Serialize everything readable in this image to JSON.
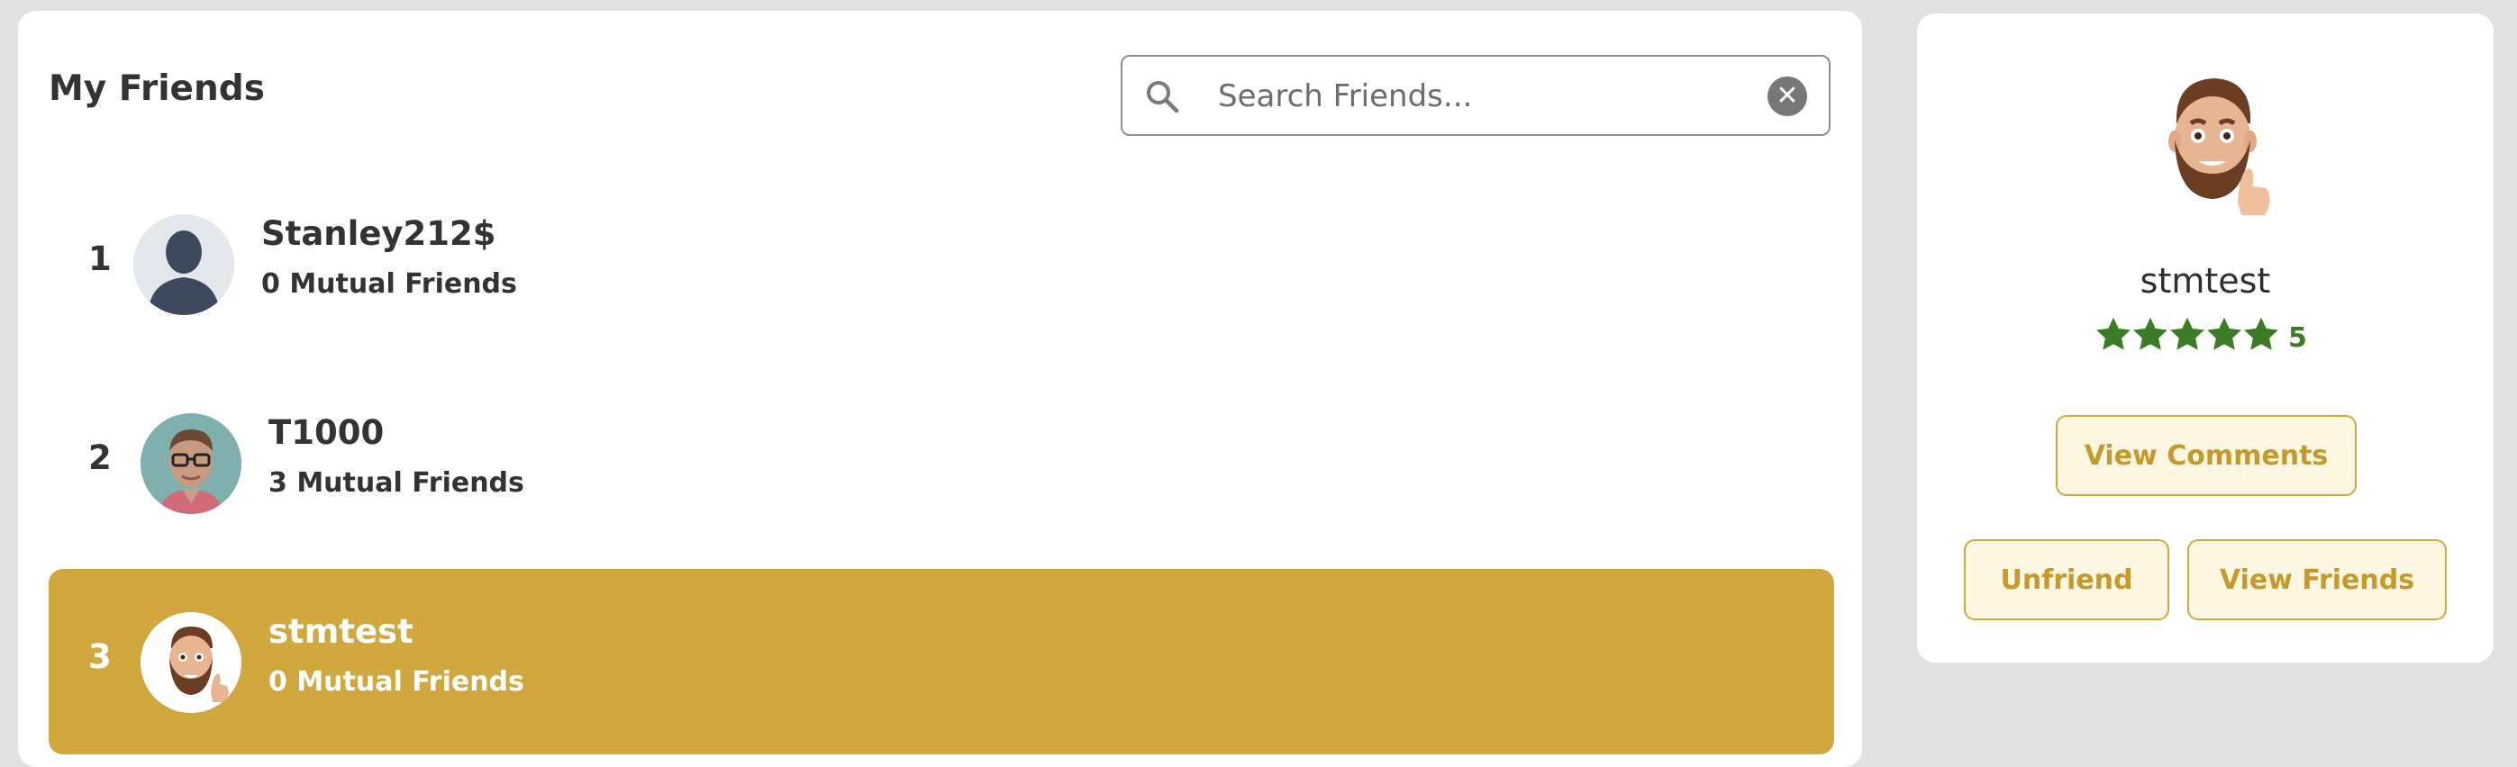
{
  "friends_panel": {
    "title": "My Friends",
    "search": {
      "placeholder": "Search Friends...",
      "value": ""
    },
    "friends": [
      {
        "rank": "1",
        "name": "Stanley212$",
        "mutual": "0 Mutual Friends",
        "avatar": "default-silhouette"
      },
      {
        "rank": "2",
        "name": "T1000",
        "mutual": "3 Mutual Friends",
        "avatar": "photo-man-glasses"
      },
      {
        "rank": "3",
        "name": "stmtest",
        "mutual": "0 Mutual Friends",
        "avatar": "memoji-thumbs-up",
        "selected": true
      }
    ]
  },
  "profile_panel": {
    "name": "stmtest",
    "rating": {
      "stars": 5,
      "value": "5",
      "star_color": "#3a7d24"
    },
    "buttons": {
      "view_comments": "View Comments",
      "unfriend": "Unfriend",
      "view_friends": "View Friends"
    }
  },
  "colors": {
    "accent": "#d0a83d",
    "button_bg": "#fdf6e1",
    "button_text": "#c59a2a",
    "page_bg": "#e2e2e2"
  }
}
